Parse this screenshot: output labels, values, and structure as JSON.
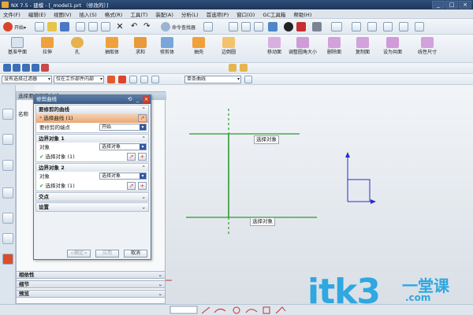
{
  "window": {
    "title": "NX 7.5 - 建模 - [_model1.prt （修改的）]"
  },
  "menu": [
    "文件(F)",
    "编辑(E)",
    "视图(V)",
    "插入(S)",
    "格式(R)",
    "工具(T)",
    "装配(A)",
    "分析(L)",
    "首选项(P)",
    "窗口(O)",
    "GC工具箱",
    "帮助(H)"
  ],
  "toolbar1": {
    "start_label": "开始▾",
    "command_finder": "命令查找器"
  },
  "toolbar2": {
    "left_buttons": [
      "基准平面",
      "拉伸",
      "孔",
      "抽取体",
      "求和",
      "修剪体",
      "抽壳",
      "边倒圆"
    ],
    "right_buttons": [
      "移动面",
      "调整圆角大小",
      "删除面",
      "复制面",
      "设为共面",
      "线性尺寸"
    ]
  },
  "toolbar3": {
    "filter_combo": "没有选择过滤器",
    "scope_combo": "仅在工作部件内部"
  },
  "toolbar4": {
    "curve_combo": "单条曲线"
  },
  "navigator": {
    "title": "选择要修剪的曲线",
    "column_header": "名称",
    "bottom_sections": [
      "相依性",
      "细节",
      "预览"
    ]
  },
  "dialog": {
    "title": "修剪曲线",
    "section1_title": "要修剪的曲线",
    "select_curve": "选择曲线 (1)",
    "end_label": "要修剪的端点",
    "end_value": "开始",
    "boundary1_title": "边界对象 1",
    "boundary2_title": "边界对象 2",
    "object_label": "对象",
    "object_value": "选择对象",
    "select_object": "选择对象 (1)",
    "intersection_title": "交点",
    "settings_title": "设置",
    "btn_ok": "<确定>",
    "btn_apply": "应用",
    "btn_cancel": "取消"
  },
  "graphics": {
    "tag_top": "选择对象",
    "tag_bottom": "选择对象"
  },
  "watermark": {
    "main": "itk3",
    "cn": "一堂课",
    "domain": ".com"
  },
  "colors": {
    "curve_green": "#2d9a2d",
    "axis_blue": "#2a2ad0",
    "accent_orange": "#e9a775"
  }
}
